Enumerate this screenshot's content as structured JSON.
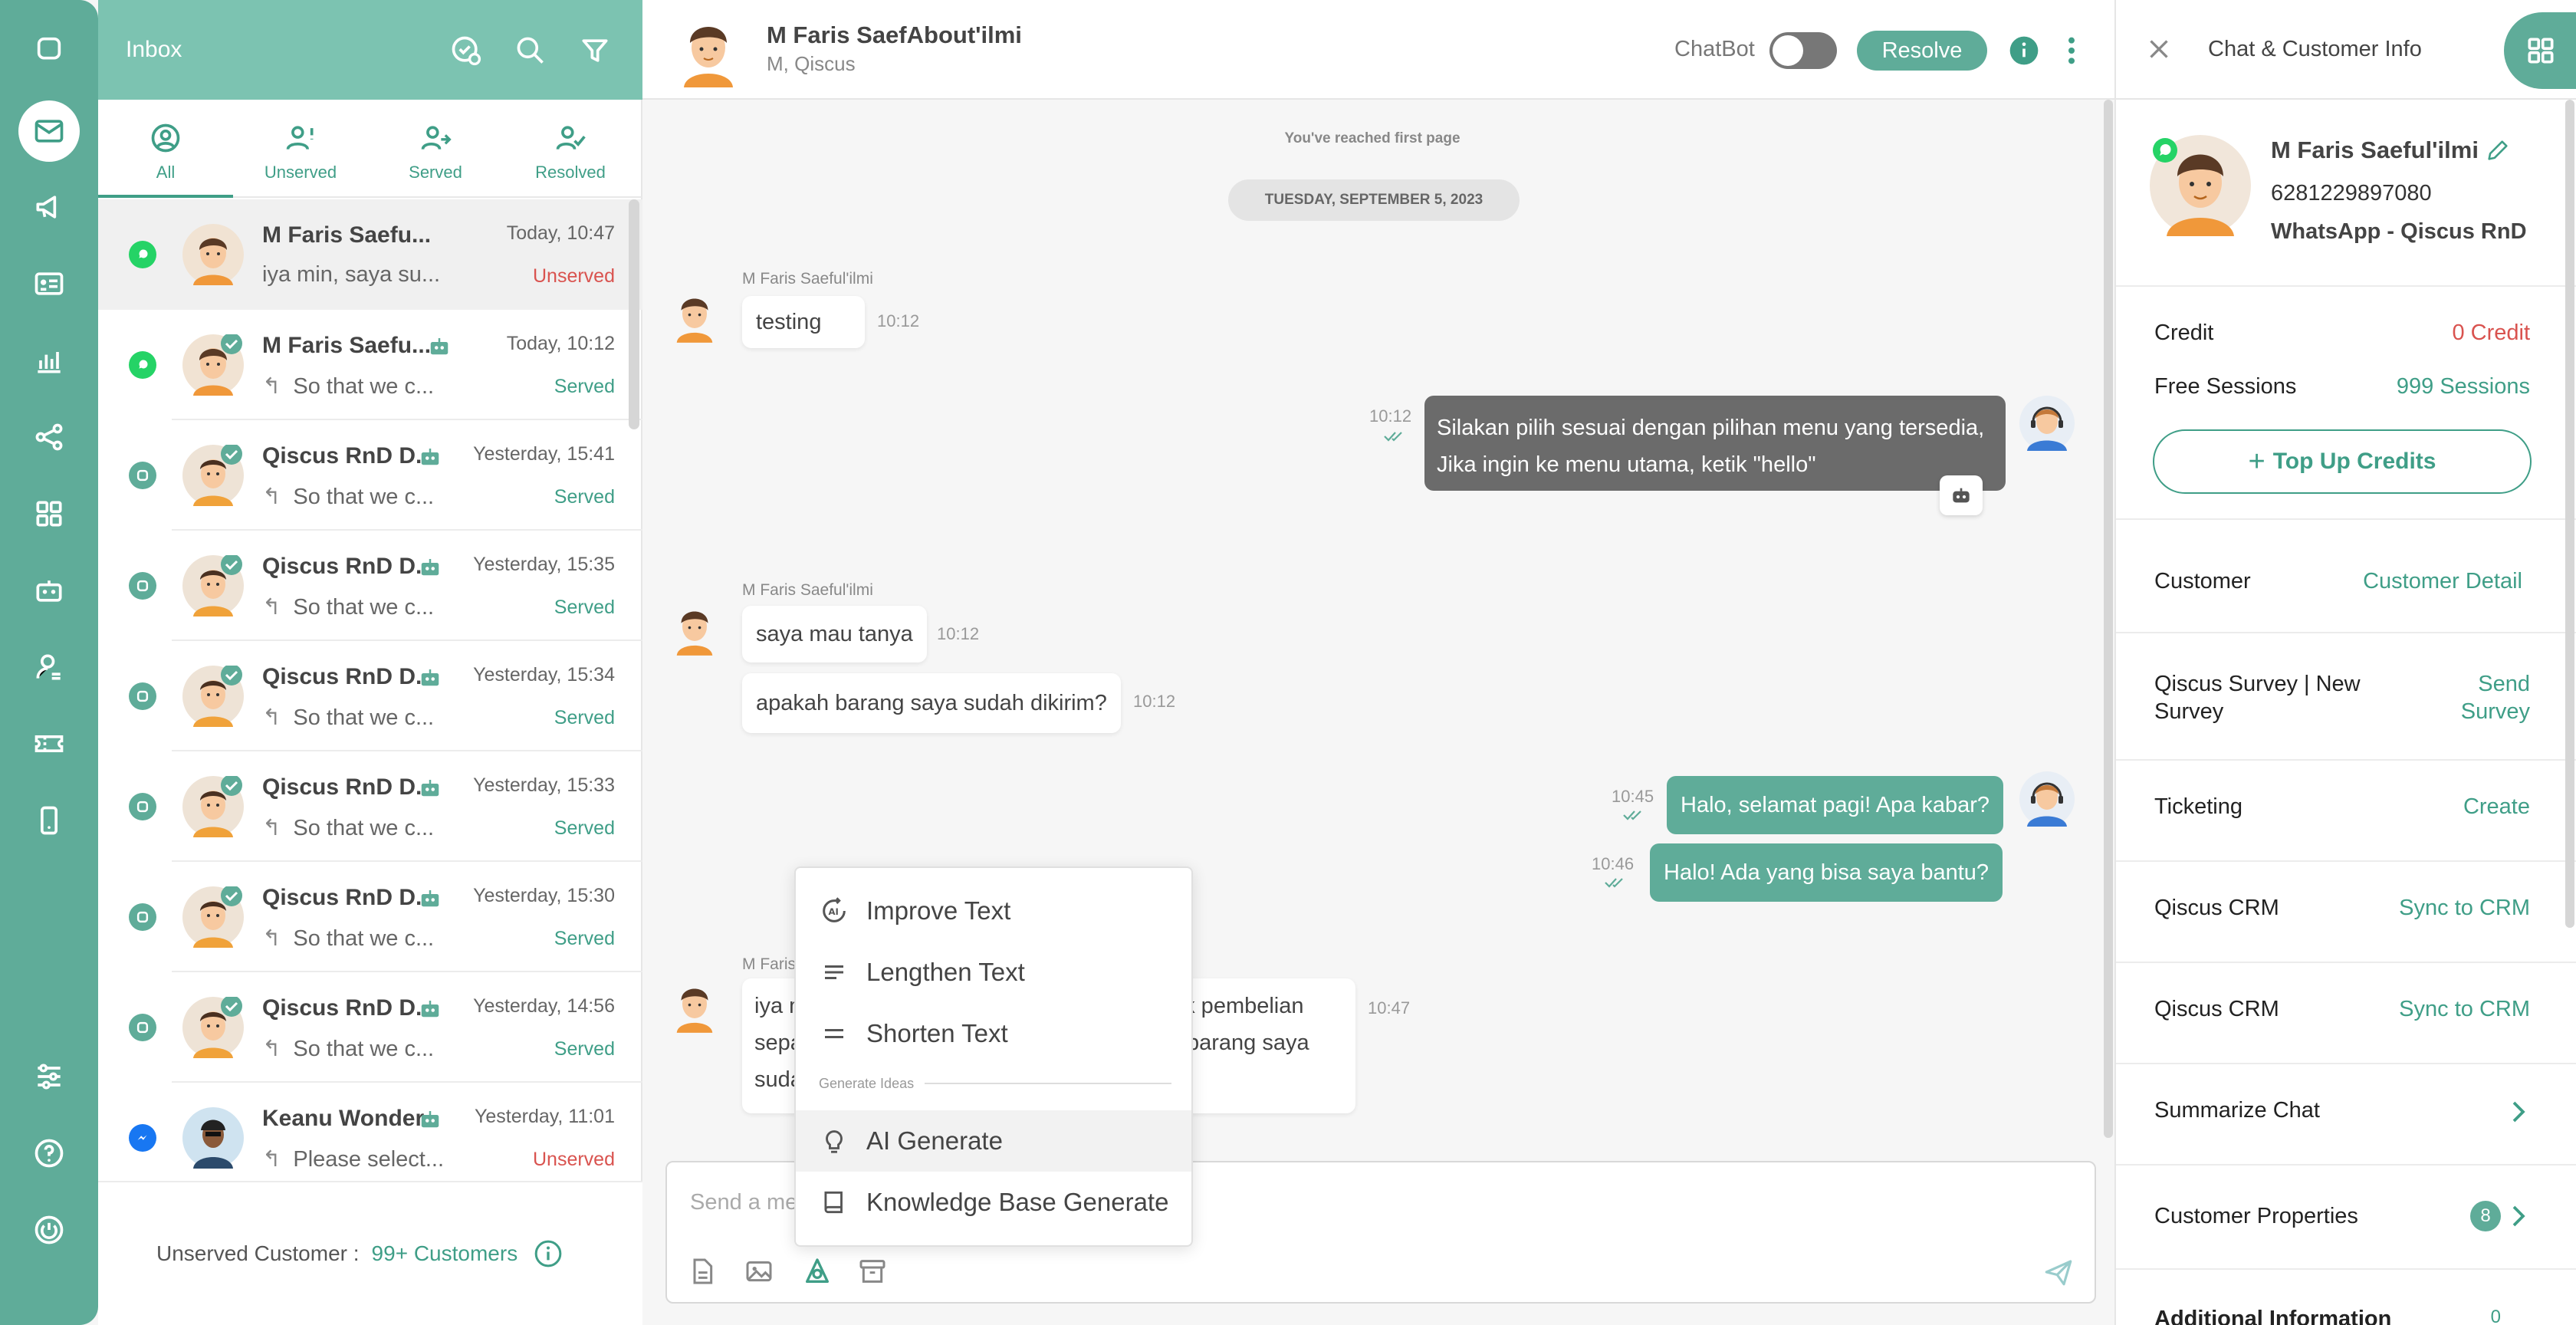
{
  "colors": {
    "accent": "#5fac99",
    "accent_dark": "#3f9e87",
    "header": "#7cc3b1",
    "danger": "#d9534f",
    "bot_bubble": "#6b6b6b"
  },
  "nav": {
    "icons": [
      "chat-square-icon",
      "inbox-icon",
      "megaphone-icon",
      "contact-card-icon",
      "analytics-icon",
      "flow-icon",
      "apps-icon",
      "bot-icon",
      "agent-icon",
      "ticket-icon",
      "mobile-icon",
      "settings-sliders-icon",
      "help-icon",
      "power-icon"
    ]
  },
  "inbox": {
    "title": "Inbox",
    "tabs": [
      {
        "label": "All"
      },
      {
        "label": "Unserved"
      },
      {
        "label": "Served"
      },
      {
        "label": "Resolved"
      }
    ],
    "conversations": [
      {
        "name": "M Faris Saefu...",
        "time": "Today, 10:47",
        "preview": "iya min, saya su...",
        "status": "Unserved"
      },
      {
        "name": "M Faris Saefu...",
        "time": "Today, 10:12",
        "preview": "So that we c...",
        "status": "Served"
      },
      {
        "name": "Qiscus RnD D...",
        "time": "Yesterday, 15:41",
        "preview": "So that we c...",
        "status": "Served"
      },
      {
        "name": "Qiscus RnD D...",
        "time": "Yesterday, 15:35",
        "preview": "So that we c...",
        "status": "Served"
      },
      {
        "name": "Qiscus RnD D...",
        "time": "Yesterday, 15:34",
        "preview": "So that we c...",
        "status": "Served"
      },
      {
        "name": "Qiscus RnD D...",
        "time": "Yesterday, 15:33",
        "preview": "So that we c...",
        "status": "Served"
      },
      {
        "name": "Qiscus RnD D...",
        "time": "Yesterday, 15:30",
        "preview": "So that we c...",
        "status": "Served"
      },
      {
        "name": "Qiscus RnD D...",
        "time": "Yesterday, 14:56",
        "preview": "So that we c...",
        "status": "Served"
      },
      {
        "name": "Keanu Wonder",
        "time": "Yesterday, 11:01",
        "preview": "Please select...",
        "status": "Unserved"
      }
    ],
    "unserved_label": "Unserved Customer :",
    "unserved_count": "99+ Customers"
  },
  "chat": {
    "contact_name": "M Faris SaefAbout'ilmi",
    "contact_sub": "M, Qiscus",
    "chatbot_label": "ChatBot",
    "resolve_label": "Resolve",
    "first_page": "You've reached first page",
    "date_chip": "TUESDAY, SEPTEMBER 5, 2023",
    "sender_name": "M Faris Saeful'ilmi",
    "messages": {
      "m1": {
        "text": "testing",
        "time": "10:12"
      },
      "m2": {
        "line1": "Silakan pilih sesuai dengan pilihan menu yang tersedia,",
        "line2": "Jika ingin ke menu utama, ketik \"hello\"",
        "time": "10:12"
      },
      "m3": {
        "text": "saya mau tanya",
        "time": "10:12"
      },
      "m4": {
        "text": "apakah barang saya sudah dikirim?",
        "time": "10:12"
      },
      "m5": {
        "text": "Halo, selamat pagi! Apa kabar?",
        "time": "10:45"
      },
      "m6": {
        "text": "Halo! Ada yang bisa saya bantu?",
        "time": "10:46"
      },
      "m7": {
        "line1a": "iya m",
        "line1b": "uk pembelian",
        "line2a": "sepa",
        "line2b": "barang saya",
        "line3a": "suda",
        "time": "10:47",
        "sender_partial": "M Faris"
      }
    },
    "input_placeholder": "Send a me"
  },
  "ai_menu": {
    "improve": "Improve Text",
    "lengthen": "Lengthen Text",
    "shorten": "Shorten Text",
    "section": "Generate Ideas",
    "ai_generate": "AI Generate",
    "kb_generate": "Knowledge Base Generate"
  },
  "info": {
    "title": "Chat & Customer Info",
    "customer_name": "M Faris Saeful'ilmi",
    "phone": "6281229897080",
    "channel": "WhatsApp - Qiscus RnD",
    "credit_label": "Credit",
    "credit_value": "0 Credit",
    "sessions_label": "Free Sessions",
    "sessions_value": "999 Sessions",
    "topup_label": "Top Up Credits",
    "customer_label": "Customer",
    "customer_link": "Customer Detail",
    "survey_label_1": "Qiscus Survey | New",
    "survey_label_2": "Survey",
    "survey_link_1": "Send",
    "survey_link_2": "Survey",
    "ticketing_label": "Ticketing",
    "ticketing_link": "Create",
    "crm1_label": "Qiscus CRM",
    "crm1_link": "Sync to CRM",
    "crm2_label": "Qiscus CRM",
    "crm2_link": "Sync to CRM",
    "summarize_label": "Summarize Chat",
    "properties_label": "Customer Properties",
    "properties_count": "8",
    "additional_label": "Additional Information",
    "additional_count": "0"
  }
}
